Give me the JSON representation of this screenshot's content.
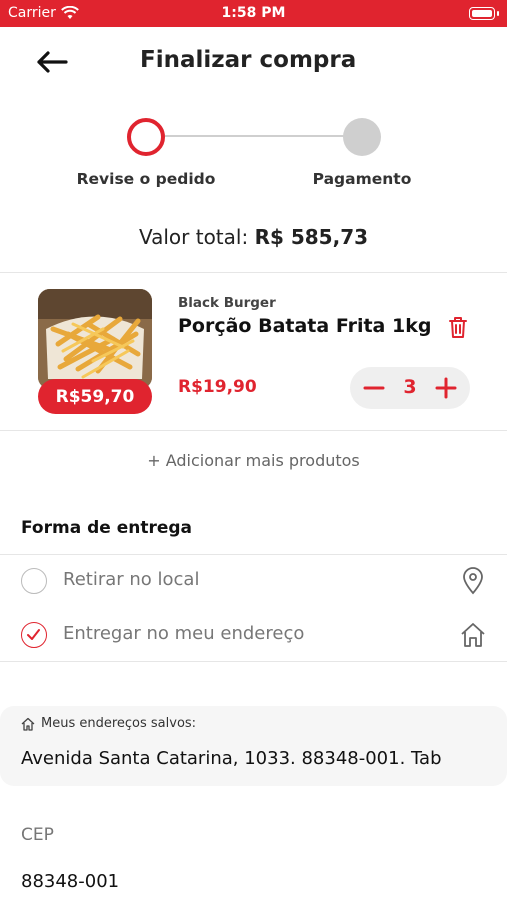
{
  "status_bar": {
    "carrier": "Carrier",
    "time": "1:58 PM"
  },
  "header": {
    "title": "Finalizar compra",
    "back_icon": "arrow-left-icon"
  },
  "stepper": {
    "steps": [
      {
        "label": "Revise o pedido",
        "active": true
      },
      {
        "label": "Pagamento",
        "active": false
      }
    ]
  },
  "total": {
    "label": "Valor total: ",
    "amount": "R$ 585,73"
  },
  "cart": {
    "items": [
      {
        "store": "Black Burger",
        "name": "Porção Batata Frita 1kg",
        "subtotal": "R$59,70",
        "unit_price": "R$19,90",
        "quantity": "3"
      }
    ]
  },
  "add_more": {
    "label": "+ Adicionar mais produtos"
  },
  "delivery": {
    "title": "Forma de entrega",
    "options": [
      {
        "label": "Retirar no local",
        "selected": false,
        "icon": "location-pin-icon"
      },
      {
        "label": "Entregar no meu endereço",
        "selected": true,
        "icon": "home-icon"
      }
    ]
  },
  "saved_addresses": {
    "label": "Meus endereços salvos:",
    "value": "Avenida Santa Catarina, 1033. 88348-001. Tab"
  },
  "cep": {
    "label": "CEP",
    "value": "88348-001"
  },
  "colors": {
    "accent": "#e0242f",
    "muted": "#777777",
    "step_inactive": "#cfcfcf"
  }
}
